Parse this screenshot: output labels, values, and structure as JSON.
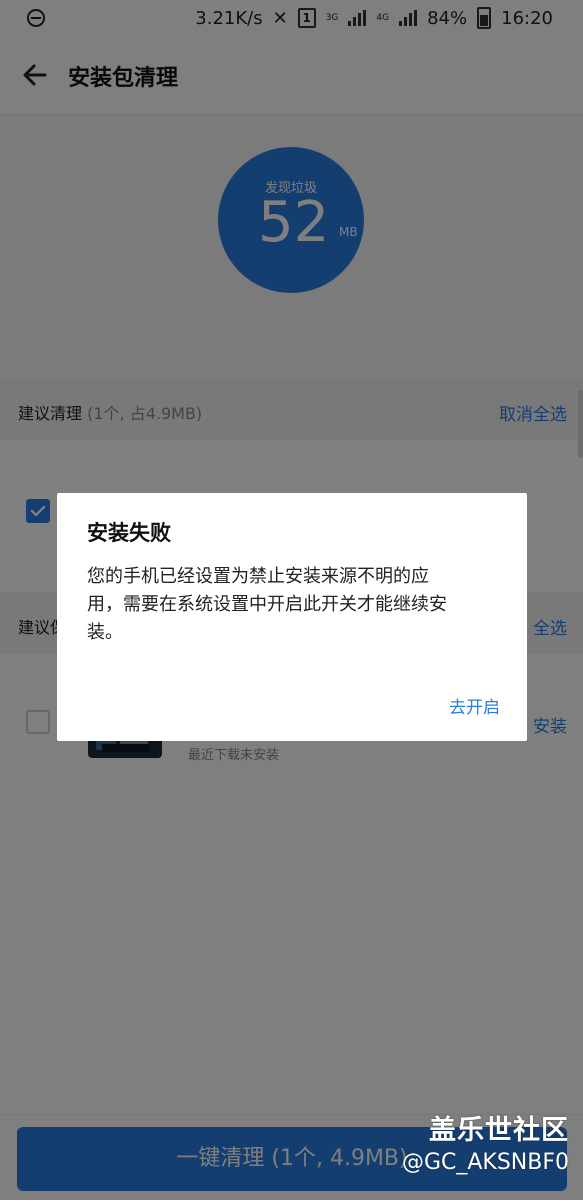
{
  "status_bar": {
    "speed": "3.21K/s",
    "sim_badge": "1",
    "net1": "3G",
    "net2": "4G",
    "battery": "84%",
    "time": "16:20"
  },
  "app_bar": {
    "title": "安装包清理"
  },
  "summary": {
    "label": "发现垃圾",
    "size_value": "52",
    "size_unit": "MB"
  },
  "section_recommended": {
    "title": "建议清理",
    "subtitle": "(1个, 占4.9MB)",
    "action": "取消全选"
  },
  "section_second": {
    "title_partial": "建议保",
    "action": "全选"
  },
  "item2": {
    "status": "最近下载未安装",
    "action": "安装"
  },
  "clean_button": {
    "label": "一键清理 (1个, 4.9MB)"
  },
  "dialog": {
    "title": "安装失败",
    "message": "您的手机已经设置为禁止安装来源不明的应用，需要在系统设置中开启此开关才能继续安装。",
    "confirm_label": "去开启"
  },
  "watermark": {
    "line1": "盖乐世社区",
    "line2": "@GC_AKSNBF0"
  },
  "colors": {
    "accent": "#2a7de1",
    "scrim": "rgba(0,0,0,0.5)"
  }
}
